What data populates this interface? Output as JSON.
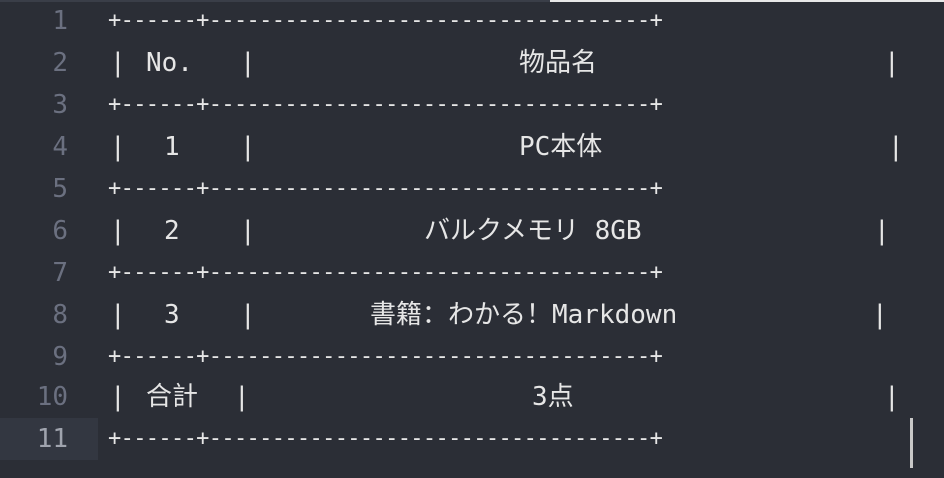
{
  "lines": [
    {
      "num": "1",
      "text": "+------+-----------------------------------+"
    },
    {
      "num": "2",
      "cells": [
        "|",
        "No.",
        "|",
        "物品名",
        "|"
      ]
    },
    {
      "num": "3",
      "text": "+------+-----------------------------------+"
    },
    {
      "num": "4",
      "cells": [
        "|",
        "1",
        "|",
        "PC本体",
        "|"
      ]
    },
    {
      "num": "5",
      "text": "+------+-----------------------------------+"
    },
    {
      "num": "6",
      "cells": [
        "|",
        "2",
        "|",
        "バルクメモリ 8GB",
        "|"
      ]
    },
    {
      "num": "7",
      "text": "+------+-----------------------------------+"
    },
    {
      "num": "8",
      "cells": [
        "|",
        "3",
        "|",
        "書籍：わかる！Markdown",
        "|"
      ]
    },
    {
      "num": "9",
      "text": "+------+-----------------------------------+"
    },
    {
      "num": "10",
      "cells": [
        "|",
        "合計",
        "|",
        "3点",
        "|"
      ]
    },
    {
      "num": "11",
      "text": "+------+-----------------------------------+"
    }
  ],
  "current_line": "11"
}
